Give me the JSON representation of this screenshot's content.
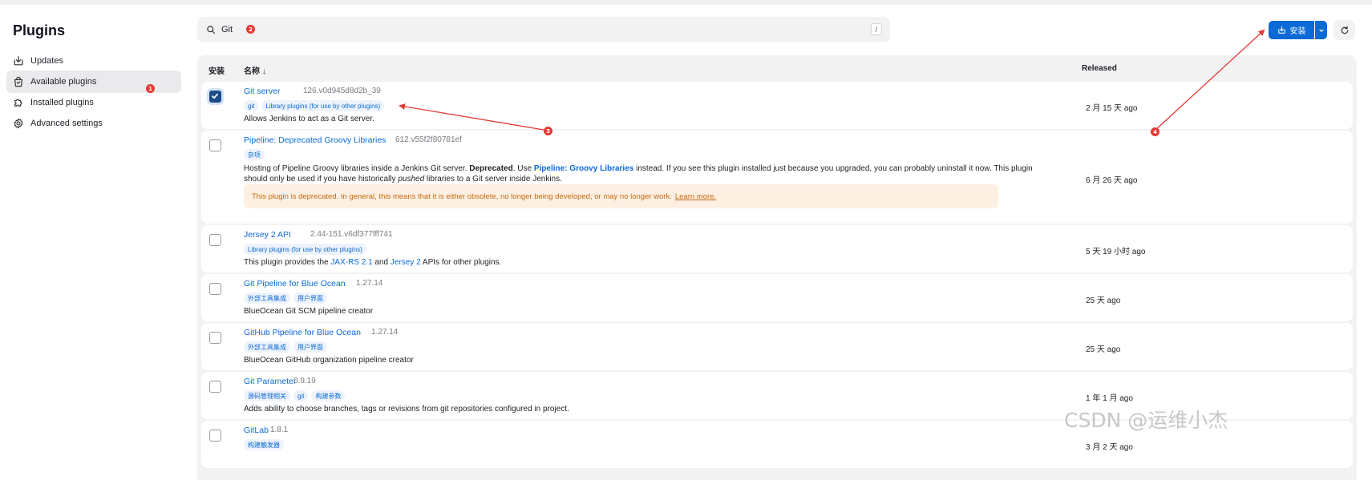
{
  "page": {
    "title": "Plugins",
    "watermark": "CSDN @运维小杰"
  },
  "sidebar": {
    "items": [
      {
        "label": "Updates",
        "icon": "download-tray-icon",
        "active": false
      },
      {
        "label": "Available plugins",
        "icon": "shopping-bag-icon",
        "active": true,
        "marker": "1"
      },
      {
        "label": "Installed plugins",
        "icon": "puzzle-icon",
        "active": false
      },
      {
        "label": "Advanced settings",
        "icon": "gear-icon",
        "active": false
      }
    ]
  },
  "search": {
    "value": "Git",
    "marker": "2",
    "shortcut": "/",
    "icon": "search-icon"
  },
  "toolbar": {
    "install_label": "安装",
    "install_icon": "install-icon",
    "dropdown_icon": "chevron-down-icon",
    "refresh_icon": "refresh-icon"
  },
  "table": {
    "headers": {
      "install": "安装",
      "name": "名称 ↓",
      "released": "Released"
    },
    "rows": [
      {
        "name": "Git server",
        "version": "126.v0d945d8d2b_39",
        "checked": true,
        "tags": [
          "git",
          "Library plugins (for use by other plugins)"
        ],
        "description": "Allows Jenkins to act as a Git server.",
        "released": "2 月 15 天 ago"
      },
      {
        "name": "Pipeline: Deprecated Groovy Libraries",
        "version": "612.v55f2f80781ef",
        "checked": false,
        "tags": [
          "杂项"
        ],
        "description_parts": {
          "p1": "Hosting of Pipeline Groovy libraries inside a Jenkins Git server. ",
          "deprecated": "Deprecated",
          "p2": ". Use ",
          "link": "Pipeline: Groovy Libraries",
          "p3": " instead. If you see this plugin installed just because you upgraded, you can probably uninstall it now. This plugin",
          "p4": "should only be used if you have historically ",
          "pushed": "pushed",
          "p5": " libraries to a Git server inside Jenkins."
        },
        "warning": "This plugin is deprecated. In general, this means that it is either obsolete, no longer being developed, or may no longer work.",
        "warning_link": "Learn more.",
        "released": "6 月 26 天 ago"
      },
      {
        "name": "Jersey 2 API",
        "version": "2.44-151.v6df377fff741",
        "checked": false,
        "tags": [
          "Library plugins (for use by other plugins)"
        ],
        "description_parts": {
          "p1": "This plugin provides the ",
          "link1": "JAX-RS 2.1",
          "p2": " and ",
          "link2": "Jersey 2",
          "p3": " APIs for other plugins."
        },
        "released": "5 天 19 小时 ago"
      },
      {
        "name": "Git Pipeline for Blue Ocean",
        "version": "1.27.14",
        "checked": false,
        "tags": [
          "外部工具集成",
          "用户界面"
        ],
        "description": "BlueOcean Git SCM pipeline creator",
        "released": "25 天 ago"
      },
      {
        "name": "GitHub Pipeline for Blue Ocean",
        "version": "1.27.14",
        "checked": false,
        "tags": [
          "外部工具集成",
          "用户界面"
        ],
        "description": "BlueOcean GitHub organization pipeline creator",
        "released": "25 天 ago"
      },
      {
        "name": "Git Parameter",
        "version": "0.9.19",
        "checked": false,
        "tags": [
          "源码管理相关",
          "git",
          "构建参数"
        ],
        "description": "Adds ability to choose branches, tags or revisions from git repositories configured in project.",
        "released": "1 年 1 月 ago"
      },
      {
        "name": "GitLab",
        "version": "1.8.1",
        "checked": false,
        "tags": [
          "构建触发器"
        ],
        "released": "3 月 2 天 ago"
      }
    ]
  },
  "annotations": {
    "marker3": "3",
    "marker4": "4",
    "color": "#e53935"
  }
}
